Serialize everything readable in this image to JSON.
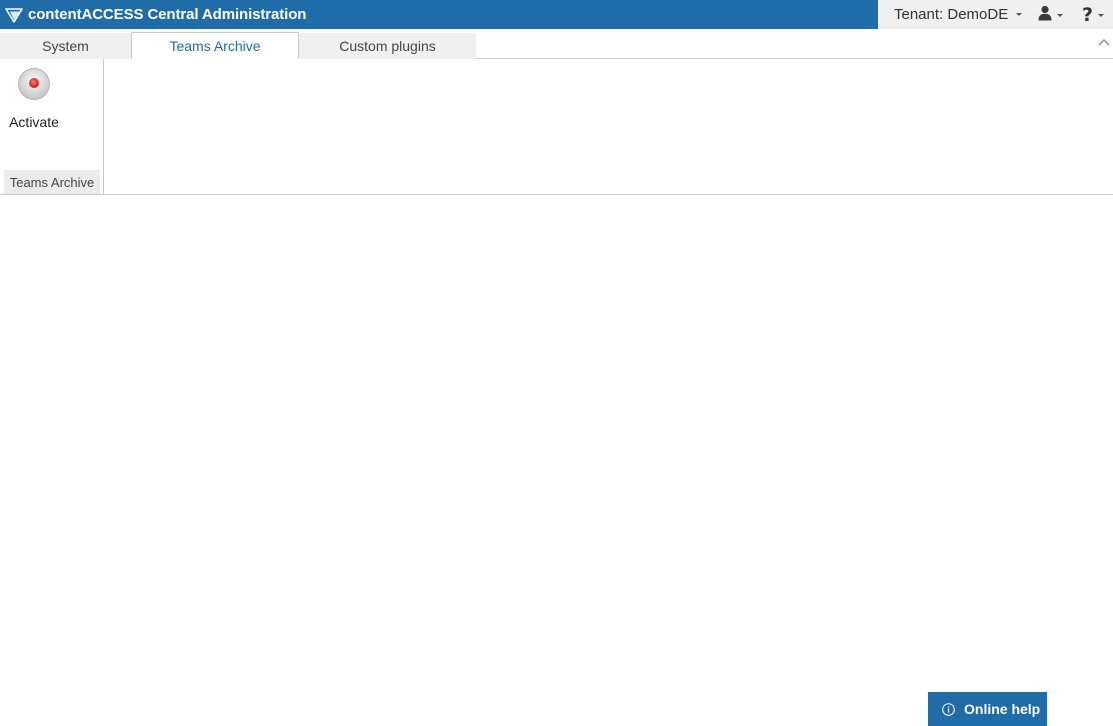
{
  "titlebar": {
    "app_title": "contentACCESS Central Administration",
    "brand_color": "#1f6ca8",
    "logo_icon": "app-logo-icon",
    "tenant_label": "Tenant: DemoDE",
    "user_icon": "user-icon",
    "help_icon": "help-icon",
    "help_glyph": "?"
  },
  "tabs": [
    {
      "label": "System",
      "active": false
    },
    {
      "label": "Teams Archive",
      "active": true
    },
    {
      "label": "Custom plugins",
      "active": false
    }
  ],
  "ribbon": {
    "activate_label": "Activate",
    "activate_icon": "record-icon",
    "group_label": "Teams Archive"
  },
  "footer": {
    "online_help_label": "Online help",
    "info_icon": "info-icon"
  }
}
